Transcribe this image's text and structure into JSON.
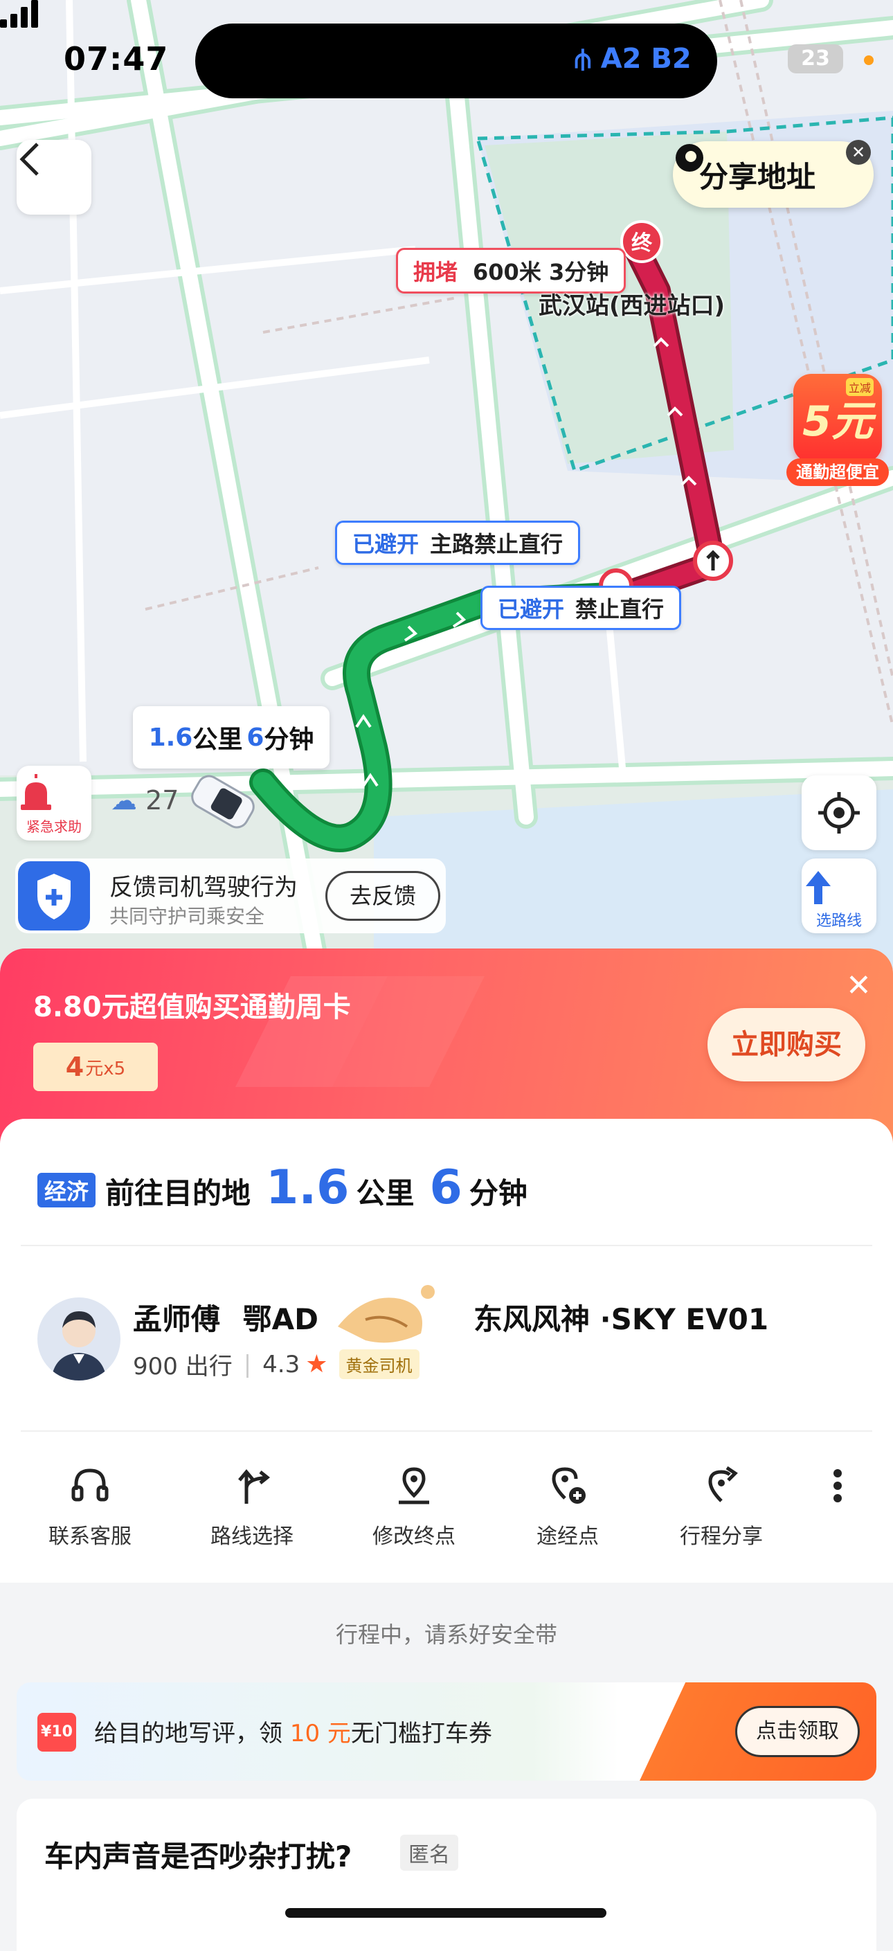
{
  "status_bar": {
    "time": "07:47",
    "metro": "A2 B2",
    "battery": "23"
  },
  "map": {
    "share_label": "分享地址",
    "jam_tag": "拥堵",
    "jam_detail": "600米 3分钟",
    "destination_pin": "终",
    "destination_name": "武汉站(西进站口)",
    "avoid1_tag": "已避开",
    "avoid1_text": "主路禁止直行",
    "avoid2_tag": "已避开",
    "avoid2_text": "禁止直行",
    "eta_distance": "1.6",
    "eta_distance_unit": "公里",
    "eta_time": "6",
    "eta_time_unit": "分钟",
    "promo5_amount": "5元",
    "promo5_badge": "立减",
    "promo5_label": "通勤超便宜",
    "sos_label": "紧急求助",
    "weather_temp": "27",
    "route_select_label": "选路线"
  },
  "feedback": {
    "title": "反馈司机驾驶行为",
    "subtitle": "共同守护司乘安全",
    "button": "去反馈"
  },
  "promo": {
    "title": "8.80元超值购买通勤周卡",
    "coupon_value": "4",
    "coupon_unit": "元x5",
    "buy_button": "立即购买"
  },
  "trip": {
    "tier": "经济",
    "text": "前往目的地",
    "distance": "1.6",
    "distance_unit": "公里",
    "time": "6",
    "time_unit": "分钟"
  },
  "driver": {
    "name": "孟师傅",
    "plate": "鄂AD",
    "car": "东风风神 ·SKY EV01",
    "rides": "900 出行",
    "rating": "4.3",
    "badge": "黄金司机"
  },
  "actions": [
    {
      "label": "联系客服",
      "icon": "headset-icon"
    },
    {
      "label": "路线选择",
      "icon": "route-choice-icon"
    },
    {
      "label": "修改终点",
      "icon": "edit-destination-icon"
    },
    {
      "label": "途经点",
      "icon": "waypoint-add-icon"
    },
    {
      "label": "行程分享",
      "icon": "share-trip-icon"
    }
  ],
  "safety_notice": "行程中，请系好安全带",
  "review": {
    "coupon_icon": "¥10",
    "text_prefix": "给目的地写评，领 ",
    "text_highlight": "10 元",
    "text_suffix": "无门槛打车券",
    "button": "点击领取"
  },
  "question": {
    "text": "车内声音是否吵杂打扰?",
    "tag": "匿名"
  },
  "colors": {
    "primary": "#2f6ce6",
    "jam": "#e8384b",
    "route_green": "#1aaa55",
    "promo_start": "#ff3d63",
    "promo_end": "#ff8d5c"
  }
}
